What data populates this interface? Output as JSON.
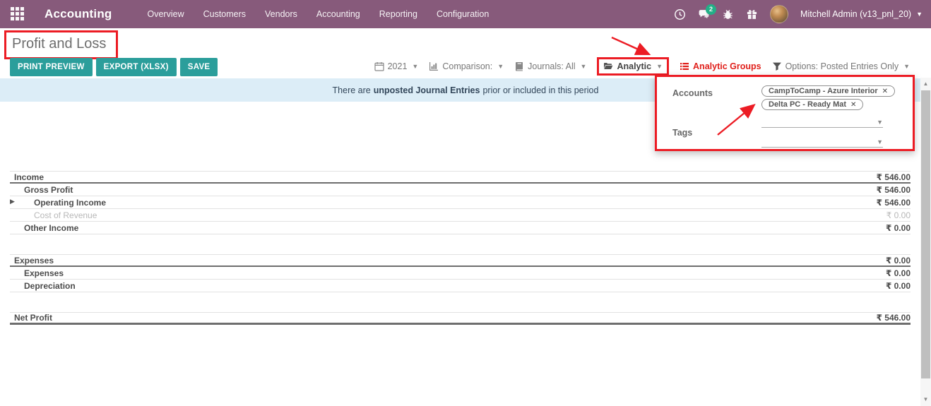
{
  "colors": {
    "brand": "#875A7B",
    "teal": "#2b9e9b",
    "annot": "#ec1c24",
    "uired": "#e0201b",
    "alertbg": "#dcedf7",
    "alerttx": "#33475b",
    "badge": "#1eb488"
  },
  "nav": {
    "app_title": "Accounting",
    "menu": [
      "Overview",
      "Customers",
      "Vendors",
      "Accounting",
      "Reporting",
      "Configuration"
    ],
    "message_count": "2",
    "user_name": "Mitchell Admin (v13_pnl_20)"
  },
  "page": {
    "title": "Profit and Loss"
  },
  "toolbar": {
    "print": "PRINT PREVIEW",
    "export": "EXPORT (XLSX)",
    "save": "SAVE"
  },
  "filters": {
    "year": "2021",
    "comparison": "Comparison:",
    "journals": "Journals: All",
    "analytic": "Analytic",
    "analytic_groups": "Analytic Groups",
    "options": "Options: Posted Entries Only"
  },
  "alert": {
    "prefix": "There are",
    "bold": "unposted Journal Entries",
    "suffix": "prior or included in this period"
  },
  "analytic_panel": {
    "accounts_label": "Accounts",
    "tags_label": "Tags",
    "account_tags": [
      "CampToCamp - Azure Interior",
      "Delta PC - Ready Mat"
    ],
    "remove_glyph": "✕"
  },
  "report": {
    "rows": [
      {
        "label": "Income",
        "value": "₹ 546.00",
        "level": 0,
        "thick": true,
        "first": true
      },
      {
        "label": "Gross Profit",
        "value": "₹ 546.00",
        "level": 1
      },
      {
        "label": "Operating Income",
        "value": "₹ 546.00",
        "level": 2,
        "caret": true
      },
      {
        "label": "Cost of Revenue",
        "value": "₹ 0.00",
        "level": 2,
        "muted": true
      },
      {
        "label": "Other Income",
        "value": "₹ 0.00",
        "level": 1
      },
      {
        "gap": true
      },
      {
        "label": "Expenses",
        "value": "₹ 0.00",
        "level": 0,
        "thick": true,
        "first": true
      },
      {
        "label": "Expenses",
        "value": "₹ 0.00",
        "level": 1
      },
      {
        "label": "Depreciation",
        "value": "₹ 0.00",
        "level": 1
      },
      {
        "gap": true
      },
      {
        "label": "Net Profit",
        "value": "₹ 546.00",
        "level": 0,
        "heavy": true,
        "first": true
      }
    ]
  }
}
